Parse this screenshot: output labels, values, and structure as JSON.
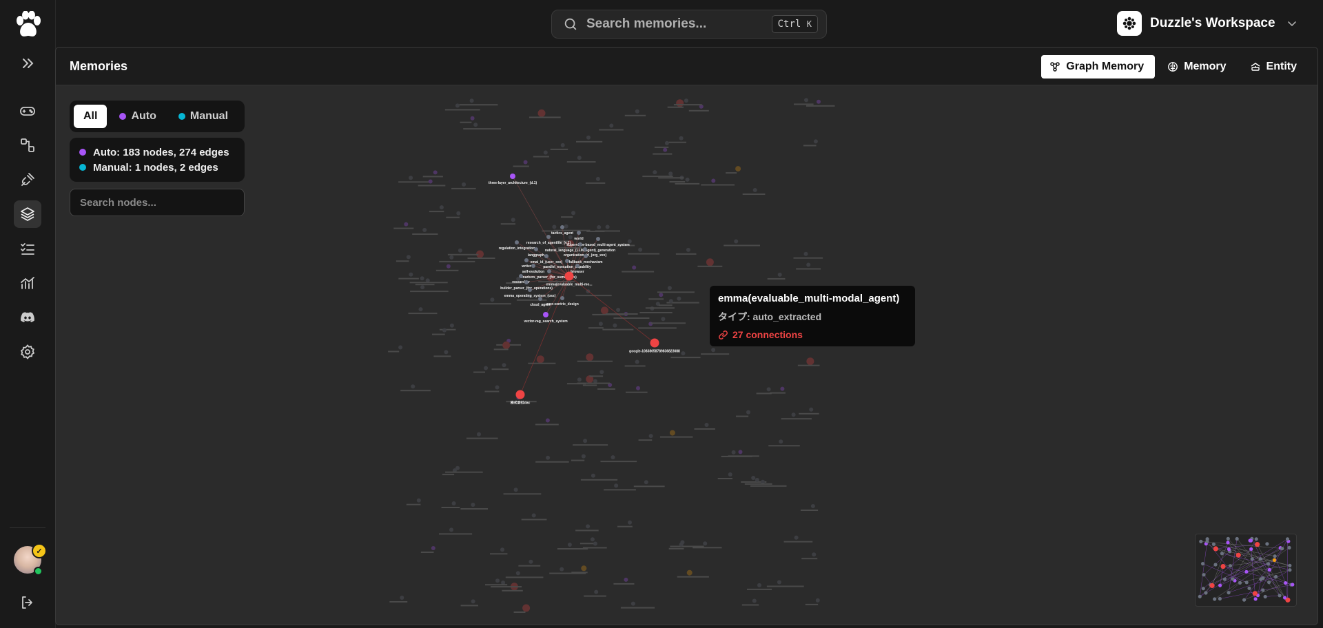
{
  "sidebar": {
    "nav": [
      "expand",
      "playground",
      "workflows",
      "plugins",
      "memories",
      "tasks",
      "analytics",
      "discord",
      "settings"
    ],
    "active": "memories"
  },
  "topbar": {
    "search_placeholder": "Search memories...",
    "shortcut_key1": "Ctrl",
    "shortcut_key2": "K",
    "workspace_name": "Duzzle's Workspace"
  },
  "page": {
    "title": "Memories",
    "tabs": [
      {
        "label": "Graph Memory",
        "icon": "graph-icon",
        "active": true
      },
      {
        "label": "Memory",
        "icon": "brain-icon",
        "active": false
      },
      {
        "label": "Entity",
        "icon": "entity-icon",
        "active": false
      }
    ]
  },
  "filters": {
    "all": "All",
    "auto": "Auto",
    "manual": "Manual",
    "selected": "All"
  },
  "stats": {
    "auto": "Auto: 183 nodes, 274 edges",
    "manual": "Manual: 1 nodes, 2 edges"
  },
  "node_search": {
    "placeholder": "Search nodes..."
  },
  "colors": {
    "auto": "#a855f7",
    "manual": "#06b6d4",
    "hub": "#ef4444",
    "default_node": "#6b7280",
    "minor": "#f59e0b"
  },
  "graph": {
    "highlight_nodes": [
      {
        "label": "three-layer_architecture_(d.1)",
        "kind": "auto"
      },
      {
        "label": "tactics_agent",
        "kind": "default"
      },
      {
        "label": "world",
        "kind": "default"
      },
      {
        "label": "research_of_agentlite_(v.1)",
        "kind": "default"
      },
      {
        "label": "supervisor-based_multi-agent_system",
        "kind": "default"
      },
      {
        "label": "regulation_integration",
        "kind": "default"
      },
      {
        "label": "natural_language_(LLM_agent)_generation",
        "kind": "default"
      },
      {
        "label": "langgraph",
        "kind": "default"
      },
      {
        "label": "organization_id_(org_xxx)",
        "kind": "default"
      },
      {
        "label": "emai_id_(user_xxx)",
        "kind": "default"
      },
      {
        "label": "fallback_mechanism",
        "kind": "default"
      },
      {
        "label": "writer",
        "kind": "default"
      },
      {
        "label": "parallel_execution_capability",
        "kind": "default"
      },
      {
        "label": "self-evolution",
        "kind": "default"
      },
      {
        "label": "browser",
        "kind": "default"
      },
      {
        "label": "markers_parser_(for_summaries)",
        "kind": "default"
      },
      {
        "label": "researcher",
        "kind": "default"
      },
      {
        "label": "emma(evaluable_multi-mo...",
        "kind": "hub"
      },
      {
        "label": "builder_parser_(for_operations)",
        "kind": "default"
      },
      {
        "label": "emma_operating_system_(oss)",
        "kind": "default"
      },
      {
        "label": "cloud_agent",
        "kind": "default"
      },
      {
        "label": "user-centric_design",
        "kind": "default"
      },
      {
        "label": "vector-rag_search_system",
        "kind": "auto"
      },
      {
        "label": "google-10838658789836823088",
        "kind": "hub"
      },
      {
        "label": "株式会社dac",
        "kind": "hub"
      }
    ]
  },
  "tooltip": {
    "title": "emma(evaluable_multi-modal_agent)",
    "type": "タイプ: auto_extracted",
    "connections": "27 connections"
  }
}
